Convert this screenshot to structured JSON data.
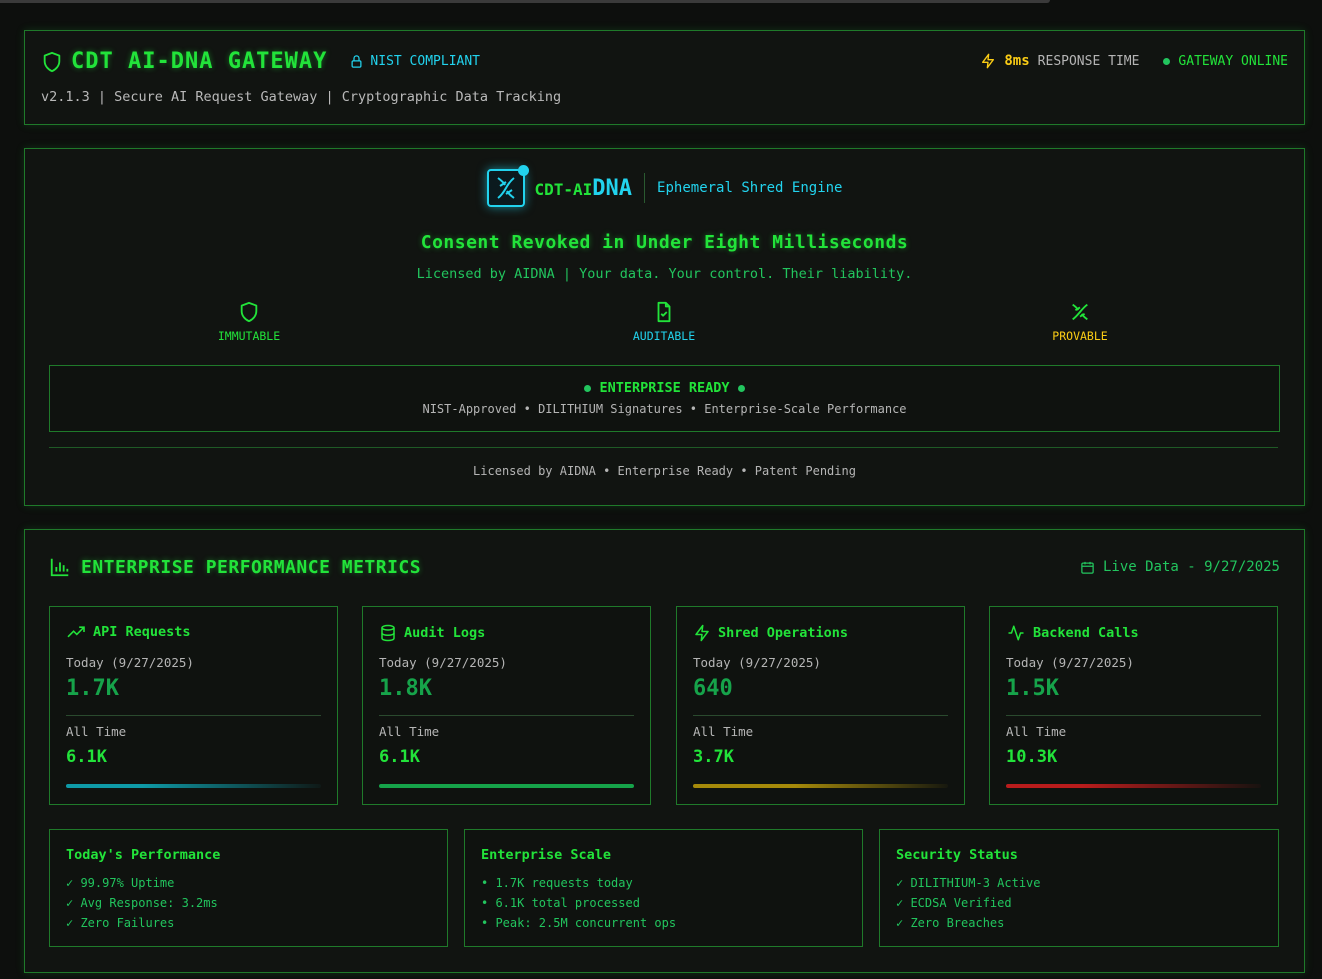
{
  "header": {
    "title": "CDT AI-DNA GATEWAY",
    "nist_badge": "NIST COMPLIANT",
    "subtitle": "v2.1.3 | Secure AI Request Gateway | Cryptographic Data Tracking",
    "response_value": "8ms",
    "response_label": "RESPONSE TIME",
    "status": "GATEWAY ONLINE"
  },
  "hero": {
    "brand_prefix": "CDT-AI",
    "brand_suffix": "DNA",
    "engine": "Ephemeral Shred Engine",
    "tagline": "Consent Revoked in Under Eight Milliseconds",
    "license_line": "Licensed by AIDNA | Your data. Your control. Their liability.",
    "features": [
      {
        "label": "IMMUTABLE",
        "icon": "shield-icon",
        "color": "#22e33a"
      },
      {
        "label": "AUDITABLE",
        "icon": "file-check-icon",
        "color": "#22d3ee"
      },
      {
        "label": "PROVABLE",
        "icon": "dna-icon",
        "color": "#facc15"
      }
    ],
    "enterprise_title": "ENTERPRISE READY",
    "enterprise_sub": "NIST-Approved • DILITHIUM Signatures • Enterprise-Scale Performance",
    "footer": "Licensed by AIDNA • Enterprise Ready • Patent Pending"
  },
  "metrics": {
    "title": "ENTERPRISE PERFORMANCE METRICS",
    "live": "Live Data - 9/27/2025",
    "cards": [
      {
        "title": "API Requests",
        "icon": "trending-up-icon",
        "today_label": "Today (9/27/2025)",
        "today_value": "1.7K",
        "all_label": "All Time",
        "all_value": "6.1K",
        "bar_color": "#0e9aa7"
      },
      {
        "title": "Audit Logs",
        "icon": "database-icon",
        "today_label": "Today (9/27/2025)",
        "today_value": "1.8K",
        "all_label": "All Time",
        "all_value": "6.1K",
        "bar_color": "#16a34a"
      },
      {
        "title": "Shred Operations",
        "icon": "zap-icon",
        "today_label": "Today (9/27/2025)",
        "today_value": "640",
        "all_label": "All Time",
        "all_value": "3.7K",
        "bar_color": "#a68a0a"
      },
      {
        "title": "Backend Calls",
        "icon": "activity-icon",
        "today_label": "Today (9/27/2025)",
        "today_value": "1.5K",
        "all_label": "All Time",
        "all_value": "10.3K",
        "bar_color": "#b91c1c"
      }
    ],
    "panels": [
      {
        "title": "Today's Performance",
        "items": [
          "✓ 99.97% Uptime",
          "✓ Avg Response: 3.2ms",
          "✓ Zero Failures"
        ]
      },
      {
        "title": "Enterprise Scale",
        "items": [
          "• 1.7K requests today",
          "• 6.1K total processed",
          "• Peak: 2.5M concurrent ops"
        ]
      },
      {
        "title": "Security Status",
        "items": [
          "✓ DILITHIUM-3 Active",
          "✓ ECDSA Verified",
          "✓ Zero Breaches"
        ]
      }
    ]
  }
}
